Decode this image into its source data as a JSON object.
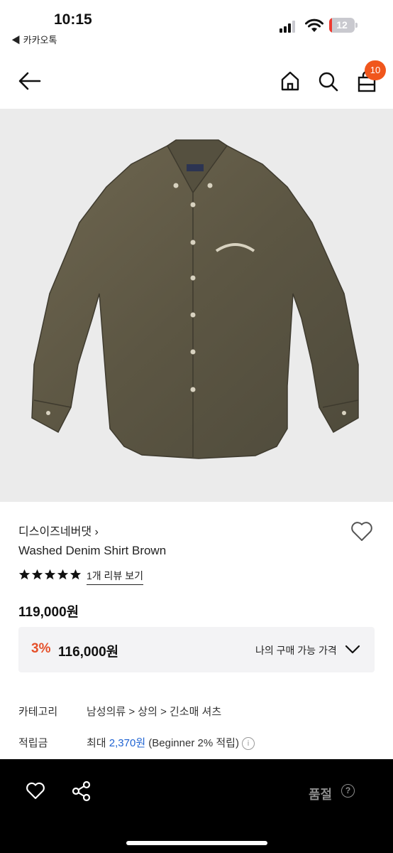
{
  "status": {
    "time": "10:15",
    "back_app": "◀ 카카오톡",
    "battery": "12",
    "battery_level_percent": 12
  },
  "nav": {
    "cart_count": "10"
  },
  "product": {
    "brand": "디스이즈네버댓 ›",
    "name": "Washed Denim Shirt Brown",
    "rating": 5,
    "review_link": "1개 리뷰 보기",
    "price": "119,000원",
    "discount_percent": "3%",
    "discount_price": "116,000원",
    "my_price_label": "나의 구매 가능 가격"
  },
  "info": {
    "category_label": "카테고리",
    "category_path": "남성의류 > 상의 > 긴소매 셔츠",
    "points_label": "적립금",
    "points_prefix": "최대 ",
    "points_amount": "2,370원",
    "points_suffix": " (Beginner 2% 적립)",
    "info_icon": "i"
  },
  "bottom": {
    "status": "품절",
    "help_icon": "?"
  },
  "colors": {
    "accent": "#f0561c",
    "discount": "#e5502a",
    "link": "#1f63d2"
  }
}
